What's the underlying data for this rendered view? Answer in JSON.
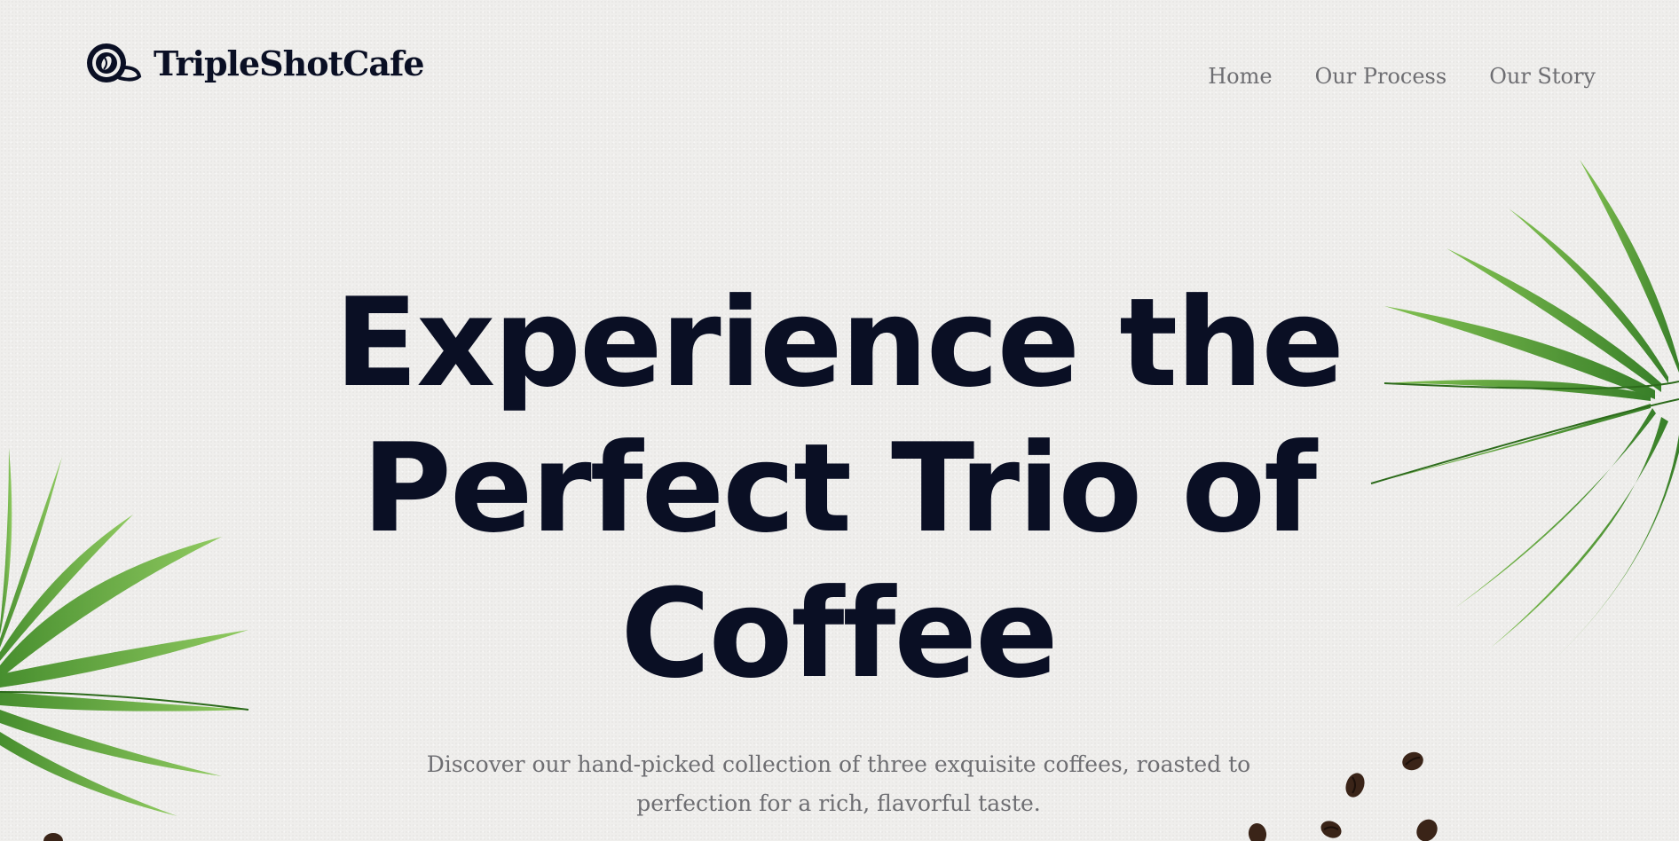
{
  "brand": {
    "name": "TripleShotCafe",
    "logo_icon": "coffee-cup-icon"
  },
  "nav": {
    "items": [
      {
        "label": "Home"
      },
      {
        "label": "Our Process"
      },
      {
        "label": "Our Story"
      }
    ]
  },
  "hero": {
    "title_line_1": "Experience the",
    "title_line_2": "Perfect Trio of",
    "title_line_3": "Coffee",
    "description": "Discover our hand-picked collection of three exquisite coffees, roasted to perfection for a rich, flavorful taste."
  },
  "colors": {
    "background": "#efeeec",
    "title": "#0a0f24",
    "muted_text": "#6e6e72",
    "leaf_green": "#4e9b2c",
    "coffee_bean": "#3a2418"
  },
  "decorations": [
    "palm-leaf-icon",
    "coffee-bean-icon"
  ]
}
